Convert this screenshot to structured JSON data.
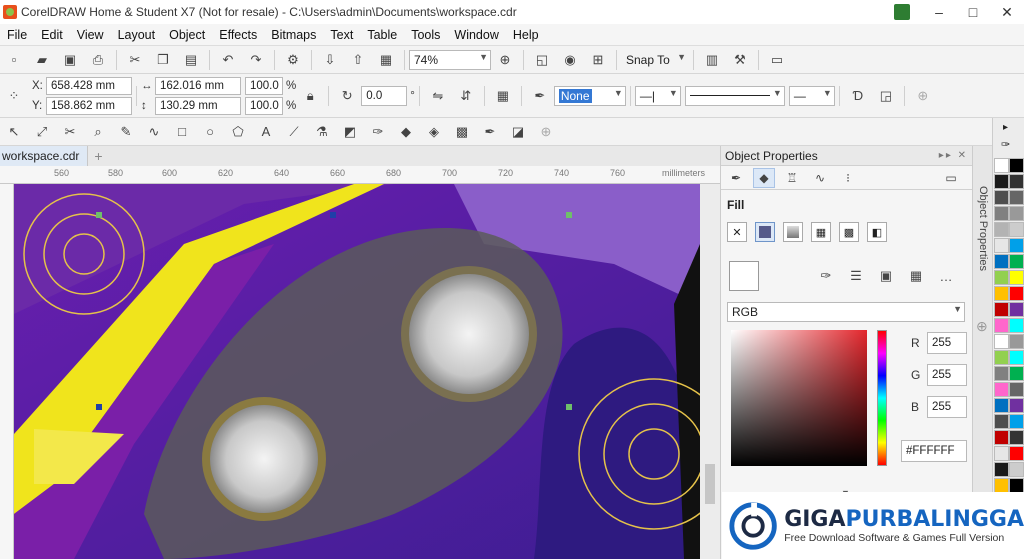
{
  "titlebar": {
    "title": "CorelDRAW Home & Student X7 (Not for resale) - C:\\Users\\admin\\Documents\\workspace.cdr",
    "minimize": "–",
    "maximize": "□",
    "close": "✕"
  },
  "menu": [
    "File",
    "Edit",
    "View",
    "Layout",
    "Object",
    "Effects",
    "Bitmaps",
    "Text",
    "Table",
    "Tools",
    "Window",
    "Help"
  ],
  "standard_toolbar": {
    "zoom_level": "74%",
    "snap_to": "Snap To"
  },
  "property_bar": {
    "x_label": "X:",
    "x_value": "658.428 mm",
    "y_label": "Y:",
    "y_value": "158.862 mm",
    "width_value": "162.016 mm",
    "height_value": "130.29 mm",
    "scale_w": "100.0",
    "scale_h": "100.0",
    "percent": "%",
    "rotation": "0.0",
    "degree": "°",
    "outline_width": "None"
  },
  "document_tab": "workspace.cdr",
  "ruler": {
    "ticks": [
      "560",
      "580",
      "600",
      "620",
      "640",
      "660",
      "680",
      "700",
      "720",
      "740",
      "760"
    ],
    "unit": "millimeters"
  },
  "docker": {
    "title": "Object Properties",
    "fill_label": "Fill",
    "color_model": "RGB",
    "r_label": "R",
    "r_value": "255",
    "g_label": "G",
    "g_value": "255",
    "b_label": "B",
    "b_value": "255",
    "hex_value": "#FFFFFF",
    "side_tab": "Object Properties"
  },
  "palette_colors": [
    "#ffffff",
    "#000000",
    "#1a1a1a",
    "#333333",
    "#4d4d4d",
    "#666666",
    "#808080",
    "#999999",
    "#b3b3b3",
    "#cccccc",
    "#e6e6e6",
    "#00a0e9",
    "#0070c0",
    "#00b050",
    "#92d050",
    "#ffff00",
    "#ffc000",
    "#ff0000",
    "#c00000",
    "#7030a0",
    "#ff66cc",
    "#00ffff"
  ],
  "watermark": {
    "title_part1": "GIGA",
    "title_part2": "PURBALINGGA",
    "subtitle": "Free Download Software & Games Full Version"
  }
}
